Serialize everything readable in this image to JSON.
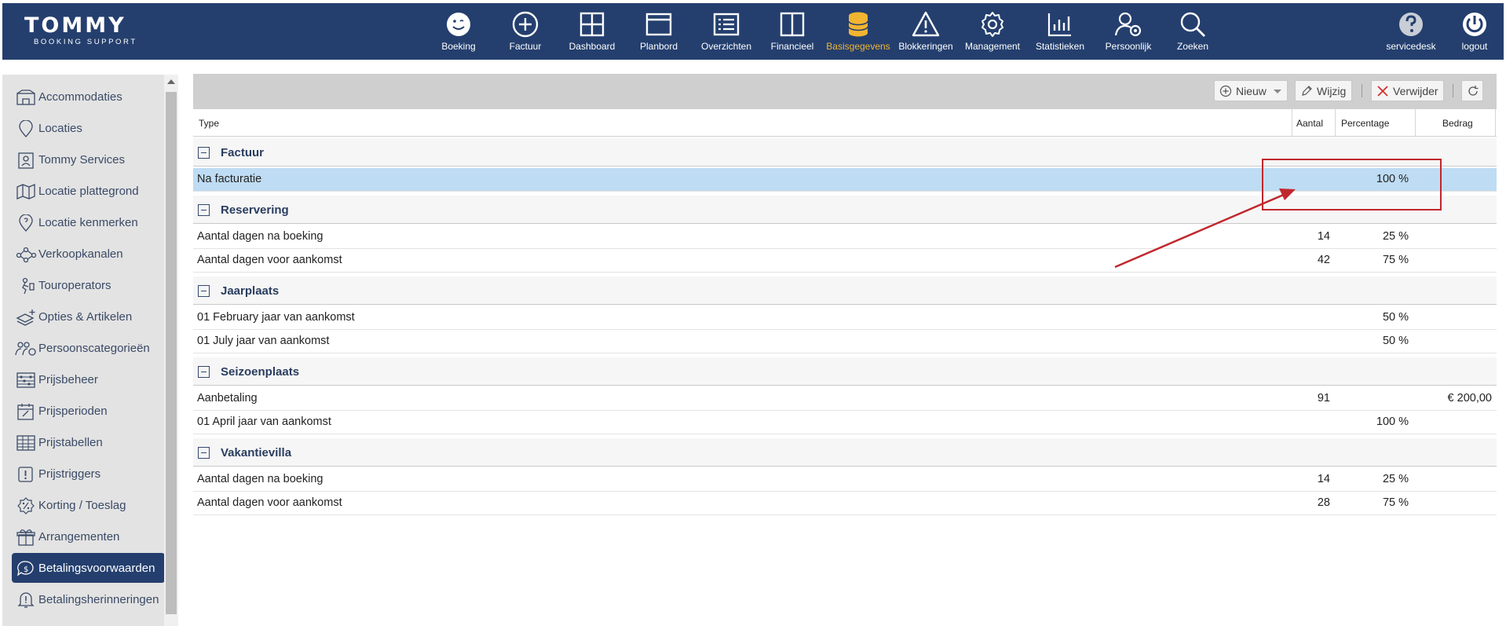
{
  "app": {
    "logo_main": "TOMMY",
    "logo_sub": "BOOKING SUPPORT"
  },
  "nav": {
    "items": [
      {
        "label": "Boeking",
        "icon": "smiley-icon"
      },
      {
        "label": "Factuur",
        "icon": "plus-circle-icon"
      },
      {
        "label": "Dashboard",
        "icon": "dashboard-grid-icon"
      },
      {
        "label": "Planbord",
        "icon": "planbord-icon"
      },
      {
        "label": "Overzichten",
        "icon": "list-icon"
      },
      {
        "label": "Financieel",
        "icon": "columns-icon"
      },
      {
        "label": "Basisgegevens",
        "icon": "database-icon"
      },
      {
        "label": "Blokkeringen",
        "icon": "warning-icon"
      },
      {
        "label": "Management",
        "icon": "gear-icon"
      },
      {
        "label": "Statistieken",
        "icon": "bar-chart-icon"
      },
      {
        "label": "Persoonlijk",
        "icon": "user-gear-icon"
      },
      {
        "label": "Zoeken",
        "icon": "search-icon"
      }
    ],
    "active": "Basisgegevens",
    "active_color": "#f2b531",
    "servicedesk": "servicedesk",
    "logout": "logout"
  },
  "sidebar": {
    "items": [
      {
        "label": "Accommodaties",
        "icon": "accommodation-icon"
      },
      {
        "label": "Locaties",
        "icon": "location-pin-icon"
      },
      {
        "label": "Tommy Services",
        "icon": "id-card-icon"
      },
      {
        "label": "Locatie plattegrond",
        "icon": "map-icon"
      },
      {
        "label": "Locatie kenmerken",
        "icon": "location-question-icon"
      },
      {
        "label": "Verkoopkanalen",
        "icon": "network-icon"
      },
      {
        "label": "Touroperators",
        "icon": "travel-icon"
      },
      {
        "label": "Opties & Artikelen",
        "icon": "layers-plus-icon"
      },
      {
        "label": "Persoonscategorieën",
        "icon": "persons-gear-icon"
      },
      {
        "label": "Prijsbeheer",
        "icon": "abacus-icon"
      },
      {
        "label": "Prijsperioden",
        "icon": "calendar-edit-icon"
      },
      {
        "label": "Prijstabellen",
        "icon": "table-icon"
      },
      {
        "label": "Prijstriggers",
        "icon": "exclamation-box-icon"
      },
      {
        "label": "Korting / Toeslag",
        "icon": "percent-badge-icon"
      },
      {
        "label": "Arrangementen",
        "icon": "gift-icon"
      },
      {
        "label": "Betalingsvoorwaarden",
        "icon": "dollar-bubble-icon"
      },
      {
        "label": "Betalingsherinneringen",
        "icon": "bell-alert-icon"
      }
    ],
    "active": "Betalingsvoorwaarden"
  },
  "toolbar": {
    "new_label": "Nieuw",
    "edit_label": "Wijzig",
    "delete_label": "Verwijder"
  },
  "table": {
    "headers": {
      "type": "Type",
      "aantal": "Aantal",
      "percentage": "Percentage",
      "bedrag": "Bedrag"
    },
    "groups": [
      {
        "name": "Factuur",
        "rows": [
          {
            "type": "Na facturatie",
            "aantal": "",
            "percentage": "100 %",
            "bedrag": "",
            "selected": true
          }
        ]
      },
      {
        "name": "Reservering",
        "rows": [
          {
            "type": "Aantal dagen na boeking",
            "aantal": "14",
            "percentage": "25 %",
            "bedrag": ""
          },
          {
            "type": "Aantal dagen voor aankomst",
            "aantal": "42",
            "percentage": "75 %",
            "bedrag": ""
          }
        ]
      },
      {
        "name": "Jaarplaats",
        "rows": [
          {
            "type": "01 February jaar van aankomst",
            "aantal": "",
            "percentage": "50 %",
            "bedrag": ""
          },
          {
            "type": "01 July jaar van aankomst",
            "aantal": "",
            "percentage": "50 %",
            "bedrag": ""
          }
        ]
      },
      {
        "name": "Seizoenplaats",
        "rows": [
          {
            "type": "Aanbetaling",
            "aantal": "91",
            "percentage": "",
            "bedrag": "€ 200,00"
          },
          {
            "type": "01 April jaar van aankomst",
            "aantal": "",
            "percentage": "100 %",
            "bedrag": ""
          }
        ]
      },
      {
        "name": "Vakantievilla",
        "rows": [
          {
            "type": "Aantal dagen na boeking",
            "aantal": "14",
            "percentage": "25 %",
            "bedrag": ""
          },
          {
            "type": "Aantal dagen voor aankomst",
            "aantal": "28",
            "percentage": "75 %",
            "bedrag": ""
          }
        ]
      }
    ]
  },
  "annotation": {
    "color": "#c0272d"
  }
}
